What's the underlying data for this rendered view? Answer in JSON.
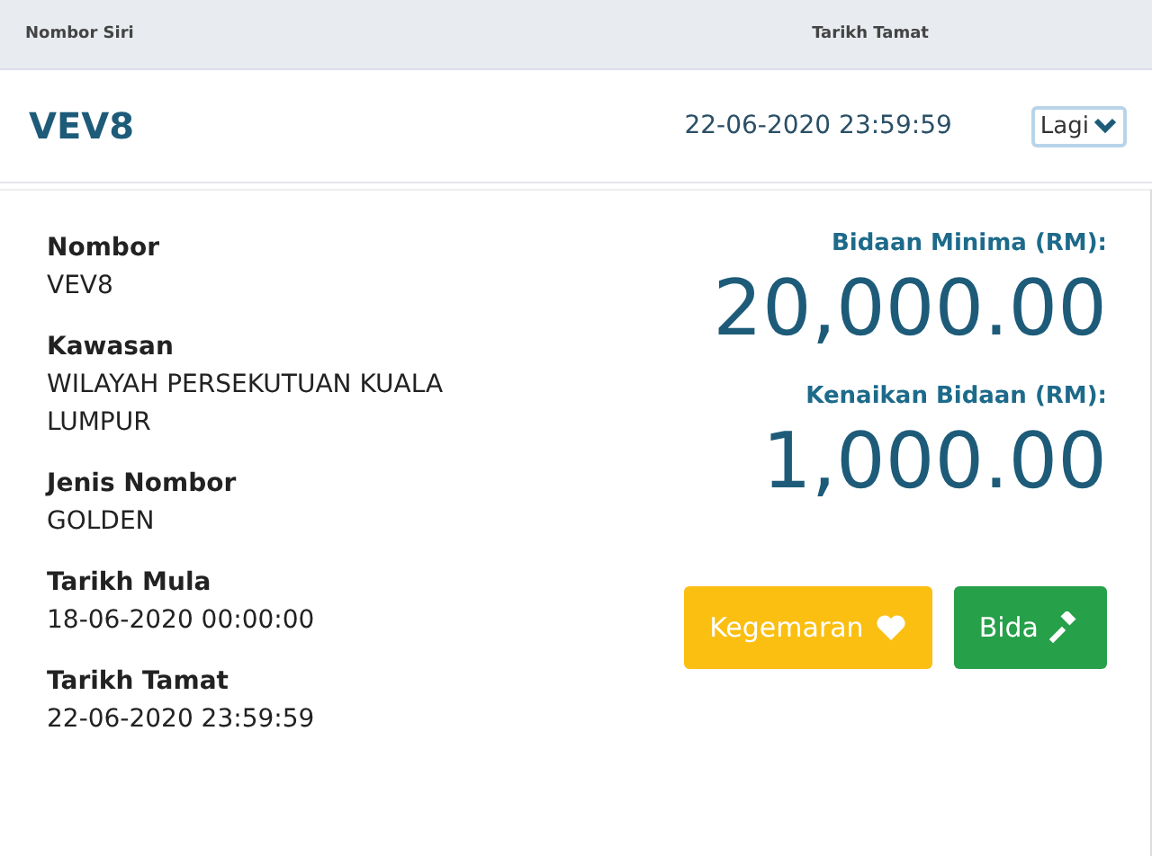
{
  "header": {
    "columns": [
      "Nombor Siri",
      "Tarikh Tamat"
    ]
  },
  "row": {
    "plate": "VEV8",
    "end_date": "22-06-2020 23:59:59",
    "more_button": "Lagi"
  },
  "details": [
    {
      "label": "Nombor",
      "value": "VEV8"
    },
    {
      "label": "Kawasan",
      "value": "WILAYAH PERSEKUTUAN KUALA LUMPUR"
    },
    {
      "label": "Jenis Nombor",
      "value": "GOLDEN"
    },
    {
      "label": "Tarikh Mula",
      "value": "18-06-2020 00:00:00"
    },
    {
      "label": "Tarikh Tamat",
      "value": "22-06-2020 23:59:59"
    }
  ],
  "prices": [
    {
      "label": "Bidaan Minima (RM):",
      "amount": "20,000.00"
    },
    {
      "label": "Kenaikan Bidaan (RM):",
      "amount": "1,000.00"
    }
  ],
  "buttons": [
    {
      "label": "Kegemaran",
      "kind": "favourite"
    },
    {
      "label": "Bida",
      "kind": "bid"
    }
  ]
}
